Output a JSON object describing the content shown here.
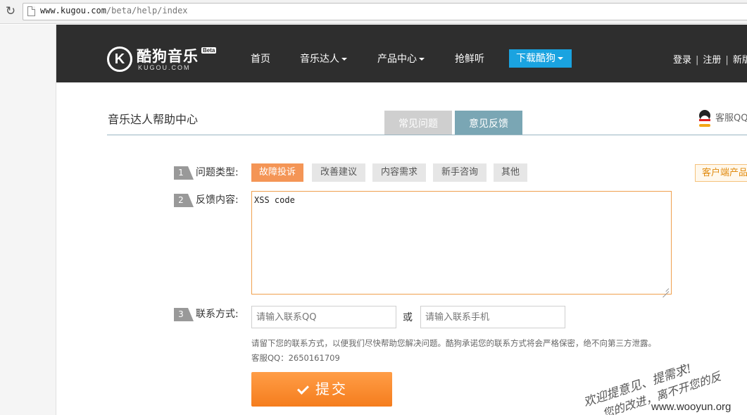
{
  "browser": {
    "url_host": "www.kugou.com",
    "url_path": "/beta/help/index",
    "reload_icon": "reload-icon"
  },
  "header": {
    "logo_glyph": "K",
    "logo_text": "酷狗音乐",
    "logo_sub": "KUGOU.COM",
    "logo_badge": "Beta",
    "nav": {
      "home": "首页",
      "music_expert": "音乐达人",
      "products": "产品中心",
      "preview": "抢鲜听",
      "download": "下载酷狗"
    },
    "user": {
      "login": "登录",
      "sep": "|",
      "register": "注册",
      "new_version": "新版"
    }
  },
  "help": {
    "title": "音乐达人帮助中心",
    "tabs": {
      "faq": "常见问题",
      "feedback": "意见反馈"
    },
    "service": "客服QQ"
  },
  "form": {
    "step1": {
      "num": "1",
      "label": "问题类型:"
    },
    "step2": {
      "num": "2",
      "label": "反馈内容:"
    },
    "step3": {
      "num": "3",
      "label": "联系方式:"
    },
    "types": [
      "故障投诉",
      "改善建议",
      "内容需求",
      "新手咨询",
      "其他"
    ],
    "active_type_index": 0,
    "client_tag": "客户端产品",
    "feedback_value": "XSS code ",
    "qq_placeholder": "请输入联系QQ",
    "or": "或",
    "phone_placeholder": "请输入联系手机",
    "note": "请留下您的联系方式，以便我们尽快帮助您解决问题。酷狗承诺您的联系方式将会严格保密，绝不向第三方泄露。",
    "qq_note": "客服QQ：2650161709",
    "submit": "提交"
  },
  "watermark": {
    "line1": "欢迎提意见、提需求!",
    "line2": "您的改进，离不开您的反",
    "site": "www.wooyun.org"
  },
  "colors": {
    "header_bg": "#2e2e2e",
    "download_blue": "#1aa3e0",
    "accent_orange": "#f49556",
    "tab_active": "#7aa6b4"
  }
}
